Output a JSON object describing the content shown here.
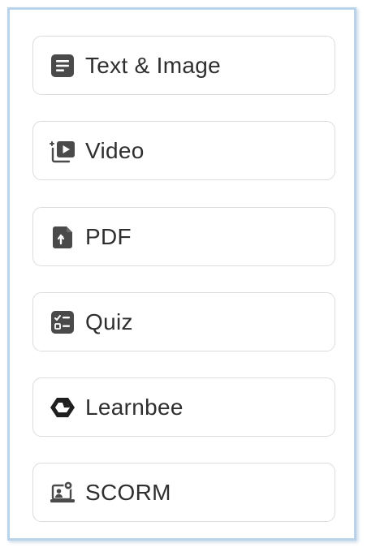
{
  "content_types": [
    {
      "label": "Text & Image",
      "icon": "text-image-icon"
    },
    {
      "label": "Video",
      "icon": "video-add-icon"
    },
    {
      "label": "PDF",
      "icon": "pdf-file-icon"
    },
    {
      "label": "Quiz",
      "icon": "quiz-checklist-icon"
    },
    {
      "label": "Learnbee",
      "icon": "learnbee-logo-icon"
    },
    {
      "label": "SCORM",
      "icon": "scorm-package-icon"
    }
  ],
  "colors": {
    "icon": "#4a4a4a",
    "text": "#2f2f2f",
    "card_border": "#dcdcdc",
    "panel_border": "#b9d4ea"
  }
}
